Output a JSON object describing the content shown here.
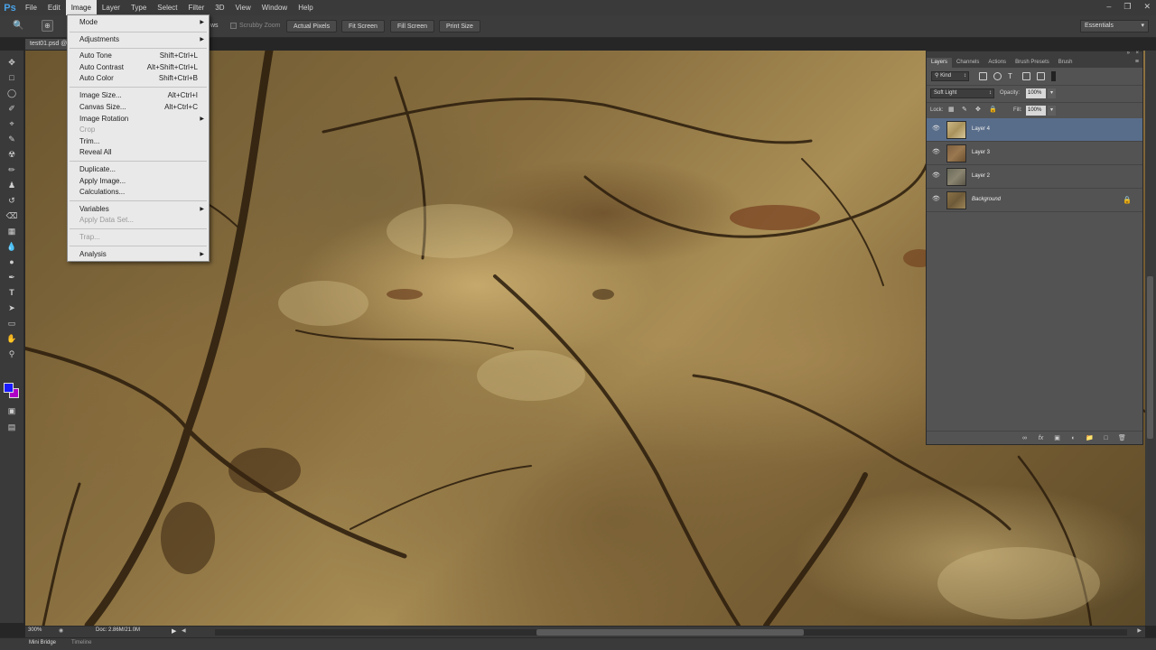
{
  "app": {
    "logo": "Ps"
  },
  "menubar": {
    "items": [
      "File",
      "Edit",
      "Image",
      "Layer",
      "Type",
      "Select",
      "Filter",
      "3D",
      "View",
      "Window",
      "Help"
    ],
    "active": "Image"
  },
  "window_controls": {
    "minimize": "–",
    "restore": "❐",
    "close": "✕"
  },
  "options_bar": {
    "partial_label": "ws",
    "scrubby_zoom": "Scrubby Zoom",
    "actual_pixels": "Actual Pixels",
    "fit_screen": "Fit Screen",
    "fill_screen": "Fill Screen",
    "print_size": "Print Size",
    "workspace": "Essentials"
  },
  "document": {
    "tab_label": "test01.psd @"
  },
  "image_menu": {
    "mode": "Mode",
    "adjustments": "Adjustments",
    "auto_tone": "Auto Tone",
    "auto_tone_sc": "Shift+Ctrl+L",
    "auto_contrast": "Auto Contrast",
    "auto_contrast_sc": "Alt+Shift+Ctrl+L",
    "auto_color": "Auto Color",
    "auto_color_sc": "Shift+Ctrl+B",
    "image_size": "Image Size...",
    "image_size_sc": "Alt+Ctrl+I",
    "canvas_size": "Canvas Size...",
    "canvas_size_sc": "Alt+Ctrl+C",
    "image_rotation": "Image Rotation",
    "crop": "Crop",
    "trim": "Trim...",
    "reveal_all": "Reveal All",
    "duplicate": "Duplicate...",
    "apply_image": "Apply Image...",
    "calculations": "Calculations...",
    "variables": "Variables",
    "apply_data_set": "Apply Data Set...",
    "trap": "Trap...",
    "analysis": "Analysis"
  },
  "layers_panel": {
    "tabs": [
      "Layers",
      "Channels",
      "Actions",
      "Brush Presets",
      "Brush"
    ],
    "kind": "Kind",
    "blend_mode": "Soft Light",
    "opacity_label": "Opacity:",
    "opacity": "100%",
    "lock_label": "Lock:",
    "fill_label": "Fill:",
    "fill": "100%",
    "layers": [
      {
        "name": "Layer 4",
        "selected": true
      },
      {
        "name": "Layer 3",
        "selected": false
      },
      {
        "name": "Layer 2",
        "selected": false
      },
      {
        "name": "Background",
        "selected": false,
        "locked": true
      }
    ]
  },
  "status": {
    "zoom": "300%",
    "doc": "Doc: 2.86M/21.0M"
  },
  "bottom_tabs": {
    "mini_bridge": "Mini Bridge",
    "timeline": "Timeline"
  },
  "colors": {
    "foreground": "#1a1aff",
    "background": "#b000c8",
    "selection": "#586d8a"
  }
}
